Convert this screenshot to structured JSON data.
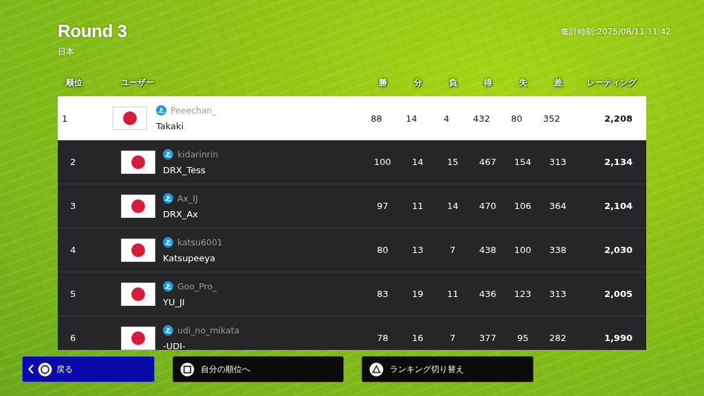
{
  "header": {
    "title": "Round 3",
    "region": "日本",
    "timestamp": "集計時刻:2025/08/11 11:42"
  },
  "columns": [
    "順位",
    "ユーザー",
    "勝",
    "分",
    "負",
    "得",
    "失",
    "差",
    "レーティング"
  ],
  "rows": [
    {
      "rank": "1",
      "psn_id": "Peeechan_",
      "name": "Takaki",
      "stats": [
        "88",
        "14",
        "4",
        "432",
        "80",
        "352"
      ],
      "rating": "2,208",
      "selected": true
    },
    {
      "rank": "2",
      "psn_id": "kidarinrin",
      "name": "DRX_Tess",
      "stats": [
        "100",
        "14",
        "15",
        "467",
        "154",
        "313"
      ],
      "rating": "2,134",
      "selected": false
    },
    {
      "rank": "3",
      "psn_id": "Ax_IJ",
      "name": "DRX_Ax",
      "stats": [
        "97",
        "11",
        "14",
        "470",
        "106",
        "364"
      ],
      "rating": "2,104",
      "selected": false
    },
    {
      "rank": "4",
      "psn_id": "katsu6001",
      "name": "Katsupeeya",
      "stats": [
        "80",
        "13",
        "7",
        "438",
        "100",
        "338"
      ],
      "rating": "2,030",
      "selected": false
    },
    {
      "rank": "5",
      "psn_id": "Goo_Pro_",
      "name": "YU_JI",
      "stats": [
        "83",
        "19",
        "11",
        "436",
        "123",
        "313"
      ],
      "rating": "2,005",
      "selected": false
    },
    {
      "rank": "6",
      "psn_id": "udi_no_mikata",
      "name": "-UDI-",
      "stats": [
        "78",
        "16",
        "7",
        "377",
        "95",
        "282"
      ],
      "rating": "1,990",
      "selected": false
    }
  ],
  "buttons": [
    {
      "label": "戻る",
      "kind": "circle",
      "selected": true
    },
    {
      "label": "自分の順位へ",
      "kind": "square",
      "selected": false
    },
    {
      "label": "ランキング切り替え",
      "kind": "triangle",
      "selected": false
    }
  ]
}
